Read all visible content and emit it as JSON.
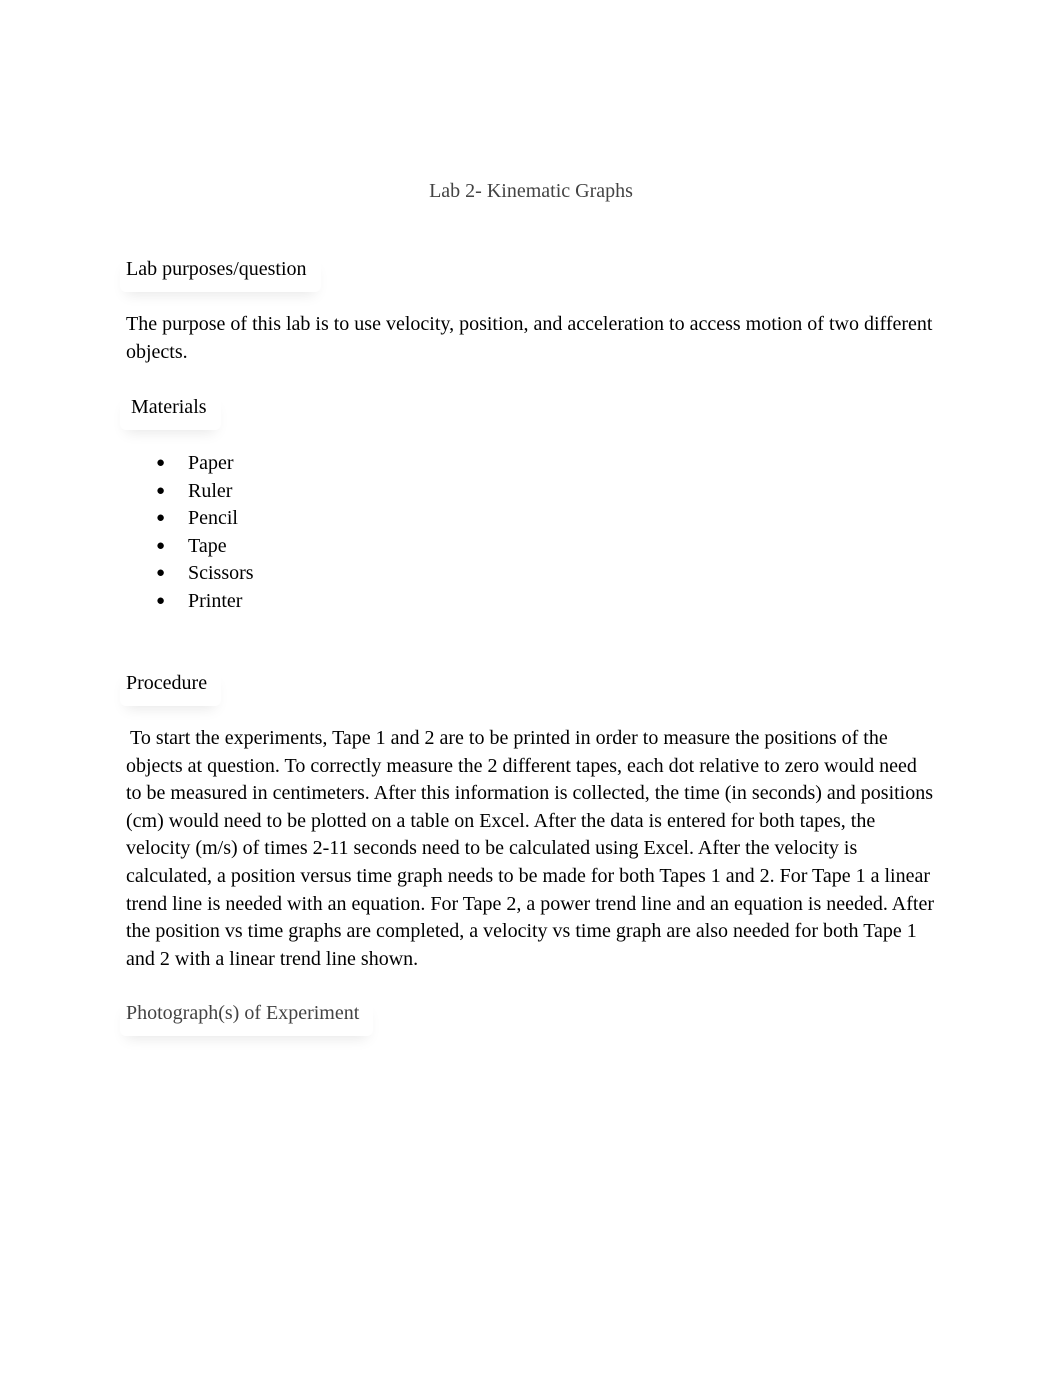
{
  "document": {
    "title": "Lab 2- Kinematic Graphs",
    "sections": {
      "purpose": {
        "heading": "Lab purposes/question",
        "body": "The purpose of this lab is to use velocity, position, and acceleration to access motion of two different objects."
      },
      "materials": {
        "heading": "Materials",
        "bullet_glyph": "●",
        "items": [
          "Paper",
          "Ruler",
          "Pencil",
          "Tape",
          "Scissors",
          "Printer"
        ]
      },
      "procedure": {
        "heading": "Procedure",
        "body": "To start the experiments, Tape 1 and 2 are to be printed in order to measure the positions of the objects at question. To correctly measure the 2 different tapes, each dot relative to zero would need to be measured in centimeters. After this information is collected, the time (in seconds) and positions (cm) would need to be plotted on a table on Excel. After the data is entered for both tapes, the velocity (m/s) of times 2-11 seconds need to be calculated using Excel. After the velocity is calculated, a position versus time graph needs to be made for both Tapes 1 and 2. For Tape 1 a linear trend line is needed with an equation. For Tape 2, a power trend line and an equation is needed. After the position vs time graphs are completed, a velocity vs time graph are also needed for both Tape 1 and 2 with a linear trend line shown."
      },
      "photographs": {
        "heading": "Photograph(s) of Experiment"
      }
    },
    "colors": {
      "body_text": "#000000",
      "muted_text": "#434343",
      "background": "#ffffff"
    }
  }
}
